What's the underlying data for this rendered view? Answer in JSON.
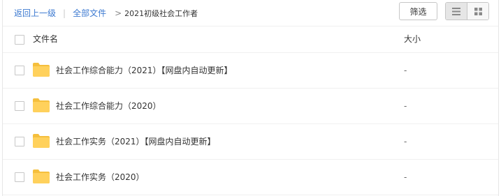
{
  "breadcrumb": {
    "back_label": "返回上一级",
    "separator": "|",
    "all_files_label": "全部文件",
    "arrow": ">",
    "current_folder": "2021初级社会工作者"
  },
  "toolbar": {
    "filter_label": "筛选",
    "view_list_icon": "list-icon",
    "view_grid_icon": "grid-icon"
  },
  "table": {
    "name_header": "文件名",
    "size_header": "大小",
    "rows": [
      {
        "name": "社会工作综合能力（2021）【网盘内自动更新】",
        "size": "-",
        "icon": "folder-icon"
      },
      {
        "name": "社会工作综合能力（2020）",
        "size": "-",
        "icon": "folder-icon"
      },
      {
        "name": "社会工作实务（2021）【网盘内自动更新】",
        "size": "-",
        "icon": "folder-icon"
      },
      {
        "name": "社会工作实务（2020）",
        "size": "-",
        "icon": "folder-icon"
      }
    ]
  },
  "colors": {
    "link": "#3d7ad1",
    "folder": "#ffd15c",
    "folder_tab": "#f5bf3d",
    "border": "#f0f0f0"
  }
}
